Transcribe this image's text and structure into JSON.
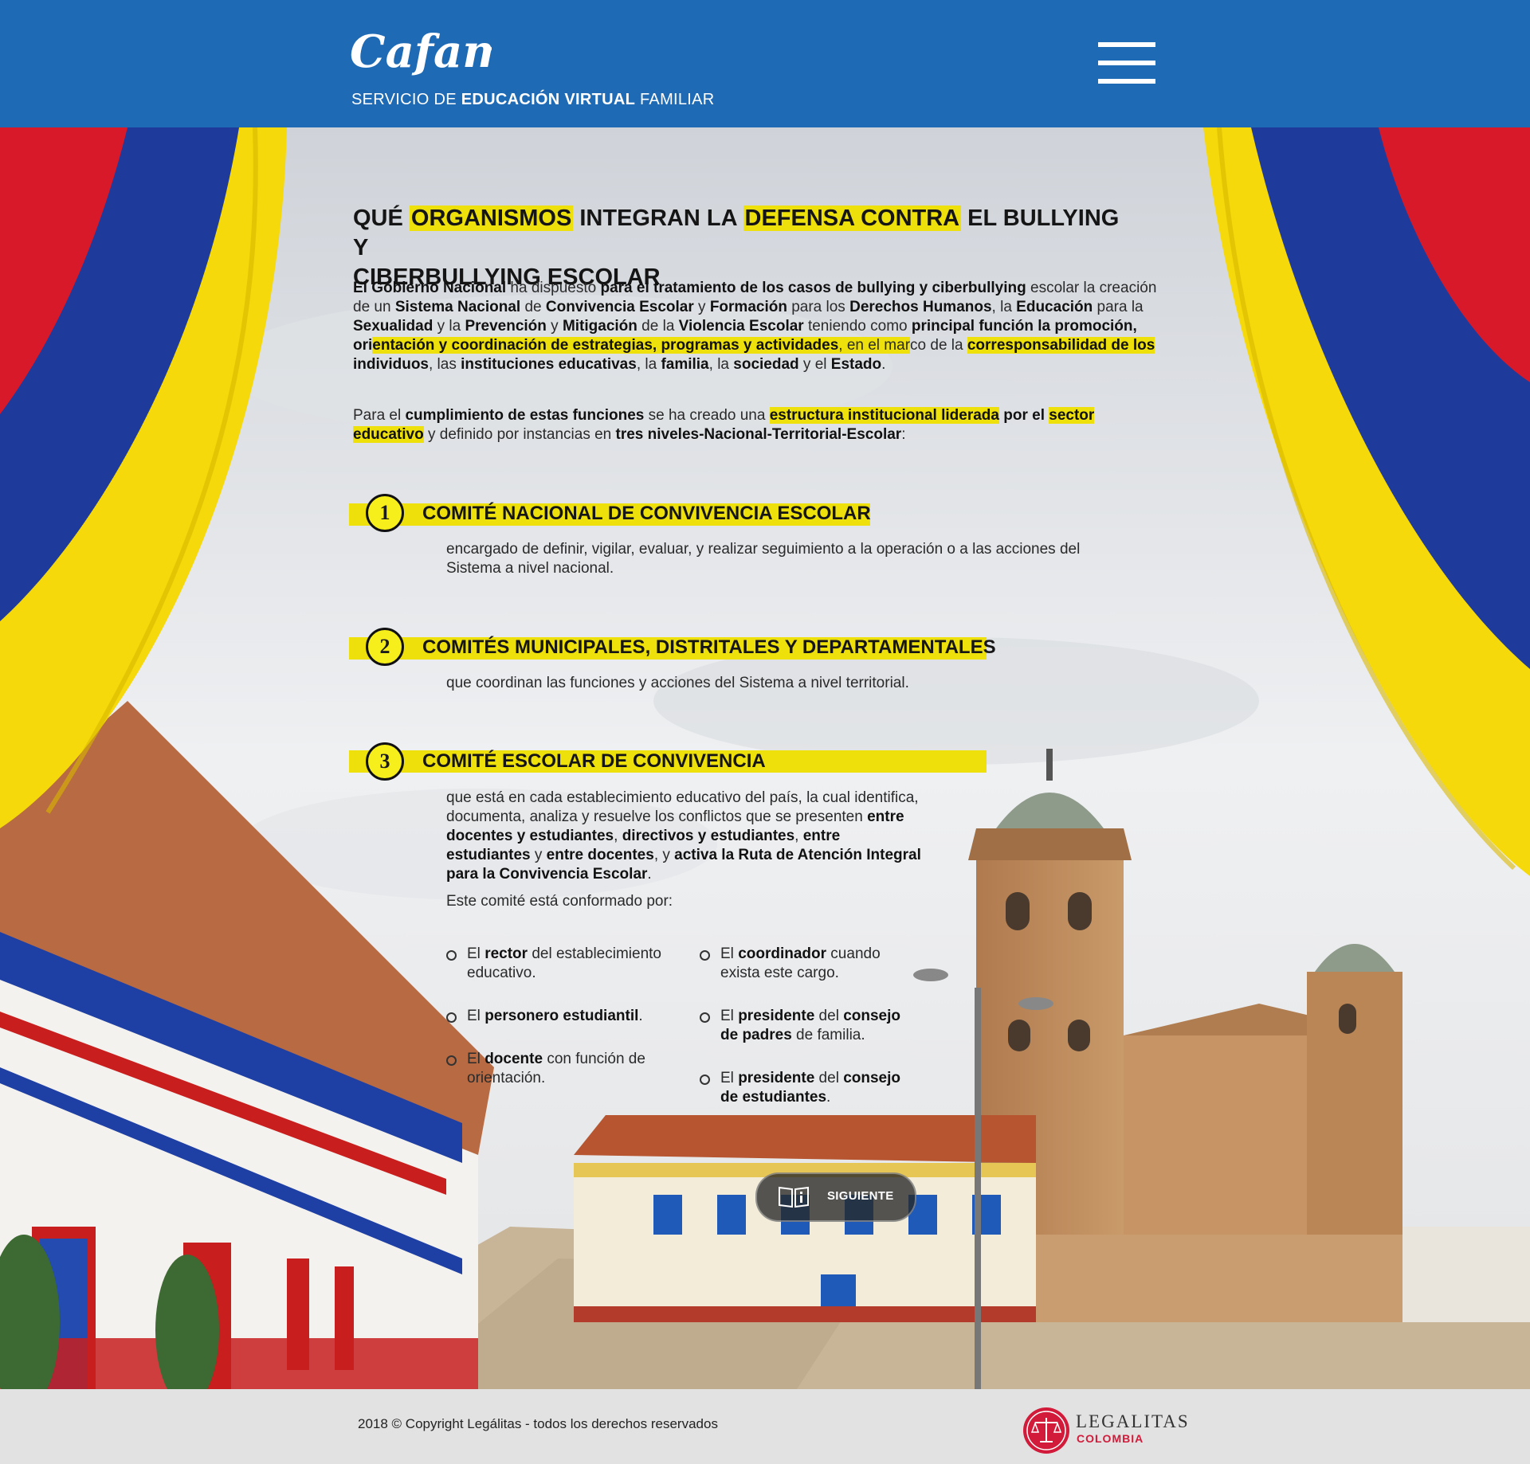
{
  "header": {
    "logo_text": "Cafam",
    "tagline_pre": "SERVICIO DE ",
    "tagline_bold": "EDUCACIÓN VIRTUAL",
    "tagline_post": " FAMILIAR",
    "menu_icon": "hamburger-menu-icon"
  },
  "title": {
    "w1": "QUÉ ",
    "w2": "ORGANISMOS",
    "w3": " INTEGRAN LA ",
    "w4": "DEFENSA CONTRA",
    "w5": " EL BULLYING Y",
    "w6": "CIBERBULLYING ESCOLAR"
  },
  "intro": {
    "p1": {
      "s1": "El Gobierno Nacional",
      "s2": " ha dispuesto ",
      "s3": "para el tratamiento de los casos de bullying y ciberbullying",
      "s4": " escolar la creación de un ",
      "s5": "Sistema Nacional",
      "s6": " de ",
      "s7": "Convivencia Escolar",
      "s8": " y ",
      "s9": "Formación",
      "s10": " para los ",
      "s11": "Derechos Humanos",
      "s12": ", la ",
      "s13": "Educación",
      "s14": " para la ",
      "s15": "Sexualidad",
      "s16": " y la ",
      "s17": "Prevención",
      "s18": " y ",
      "s19": "Mitigación",
      "s20": " de la ",
      "s21": "Violencia Escolar",
      "s22": " teniendo como ",
      "s23": "principal función la promoción, ori",
      "s24": "entación y coordinación de estrategias, programas y actividades",
      "s25": ", en el mar",
      "s26": "co de la ",
      "s27": "corresponsabilidad de los",
      "s28": " individuos",
      "s29": ", las ",
      "s30": "instituciones educativas",
      "s31": ", la ",
      "s32": "familia",
      "s33": ", la ",
      "s34": "sociedad",
      "s35": " y el ",
      "s36": "Estado",
      "s37": "."
    },
    "p2": {
      "s1": "Para el ",
      "s2": "cumplimiento de estas funciones",
      "s3": " se ha creado una ",
      "s4": "estructura institucional liderada",
      "s5": " por el ",
      "s6": "sector educativo",
      "s7": " y definido por instancias en ",
      "s8": "tres niveles-Nacional-Territorial-Escolar",
      "s9": ":"
    }
  },
  "steps": [
    {
      "num": "1",
      "title": "COMITÉ NACIONAL DE CONVIVENCIA ESCOLAR",
      "desc": "encargado de definir, vigilar, evaluar, y realizar seguimiento a la operación o a las acciones del Sistema a nivel nacional."
    },
    {
      "num": "2",
      "title": "COMITÉS MUNICIPALES, DISTRITALES Y DEPARTAMENTALES",
      "desc": "que coordinan las funciones y acciones del Sistema a nivel territorial."
    },
    {
      "num": "3",
      "title": "COMITÉ ESCOLAR DE CONVIVENCIA",
      "desc": {
        "s1": "que está en cada establecimiento educativo del país, la cual identifica, documenta, analiza y resuelve los conflictos que se presenten ",
        "s2": "entre docentes y estudiantes",
        "s3": ", ",
        "s4": "directivos y estudiantes",
        "s5": ", ",
        "s6": "entre estudiantes",
        "s7": " y ",
        "s8": "entre docentes",
        "s9": ", y ",
        "s10": "activa la Ruta de Atención Integral para la Convivencia Escolar",
        "s11": "."
      },
      "members_intro": "Este comité está conformado por:"
    }
  ],
  "members": [
    {
      "pre": "El ",
      "bold": "rector",
      "post": " del establecimiento educativo."
    },
    {
      "pre": "El ",
      "bold": "personero estudiantil",
      "post": "."
    },
    {
      "pre": "El ",
      "bold": "docente",
      "post": " con función de orientación."
    },
    {
      "pre": "El ",
      "bold": "coordinador",
      "post": " cuando exista este cargo."
    },
    {
      "pre": "El ",
      "bold": "presidente",
      "mid": " del ",
      "bold2": "consejo de padres",
      "post": " de familia."
    },
    {
      "pre": "El ",
      "bold": "presidente",
      "mid": " del ",
      "bold2": "consejo de estudiantes",
      "post": "."
    }
  ],
  "next_button": {
    "label": "SIGUIENTE",
    "icon": "book-info-icon"
  },
  "footer": {
    "copyright": "2018 © Copyright Legálitas - todos los derechos reservados",
    "brand_name": "LEGALITAS",
    "brand_country": "COLOMBIA",
    "brand_icon": "scales-of-justice-icon"
  },
  "colors": {
    "header_blue": "#1f6ab4",
    "highlight_yellow": "#eee00b",
    "flag_yellow": "#f5d90a",
    "flag_blue": "#1e3a9a",
    "flag_red": "#d8192a",
    "brand_red": "#d21b3a"
  }
}
